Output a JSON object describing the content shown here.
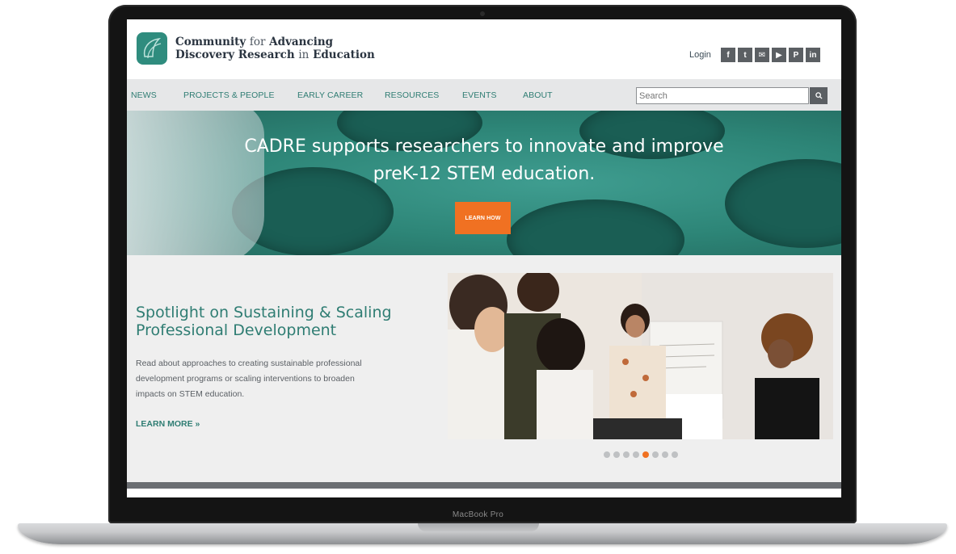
{
  "device": {
    "label": "MacBook Pro"
  },
  "header": {
    "logo_line1_a": "Community",
    "logo_line1_b": "for",
    "logo_line1_c": "Advancing",
    "logo_line2_a": "Discovery Research",
    "logo_line2_b": "in",
    "logo_line2_c": "Education",
    "login": "Login",
    "social": [
      {
        "icon": "facebook-icon",
        "glyph": "f"
      },
      {
        "icon": "twitter-icon",
        "glyph": "t"
      },
      {
        "icon": "email-icon",
        "glyph": "✉"
      },
      {
        "icon": "youtube-icon",
        "glyph": "▶"
      },
      {
        "icon": "pinterest-icon",
        "glyph": "P"
      },
      {
        "icon": "linkedin-icon",
        "glyph": "in"
      }
    ]
  },
  "nav": {
    "items": [
      "NEWS",
      "PROJECTS & PEOPLE",
      "EARLY CAREER",
      "RESOURCES",
      "EVENTS",
      "ABOUT"
    ],
    "search_placeholder": "Search"
  },
  "hero": {
    "title_line1": "CADRE supports researchers to innovate and improve",
    "title_line2": "preK-12 STEM education.",
    "button": "LEARN HOW"
  },
  "spotlight": {
    "title_line1": "Spotlight on Sustaining & Scaling",
    "title_line2": "Professional Development",
    "body_line1": "Read about approaches to creating sustainable professional",
    "body_line2": "development programs or scaling interventions to broaden",
    "body_line3": "impacts on STEM education.",
    "link": "LEARN MORE »",
    "slides_total": 8,
    "active_slide": 5
  },
  "colors": {
    "teal": "#2f7d73",
    "orange": "#f07122",
    "nav_bg": "#e6e7e8",
    "social_bg": "#5b5f63"
  }
}
